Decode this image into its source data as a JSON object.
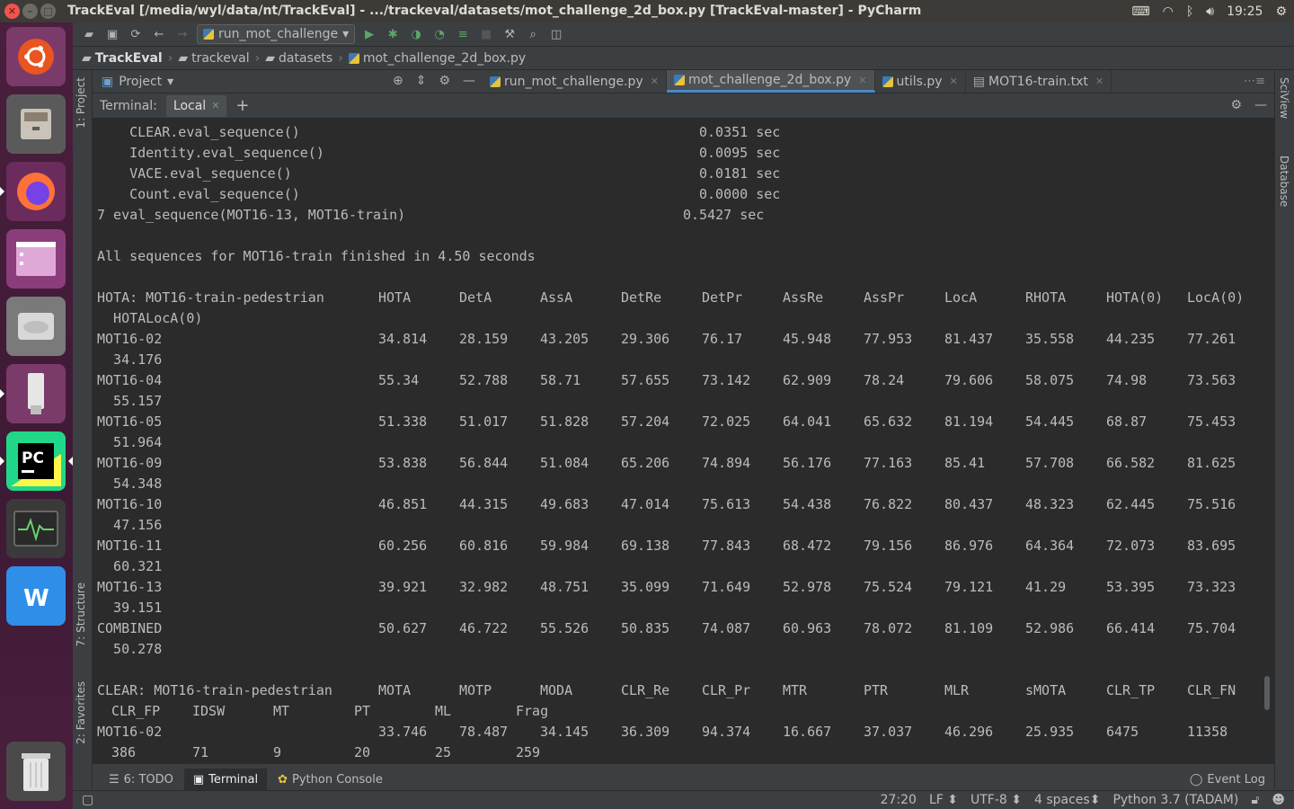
{
  "window": {
    "title": "TrackEval [/media/wyl/data/nt/TrackEval] - .../trackeval/datasets/mot_challenge_2d_box.py [TrackEval-master] - PyCharm",
    "clock": "19:25"
  },
  "toolbar": {
    "run_config": "run_mot_challenge"
  },
  "breadcrumb": [
    "TrackEval",
    "trackeval",
    "datasets",
    "mot_challenge_2d_box.py"
  ],
  "project_panel": {
    "label": "Project"
  },
  "editor_tabs": [
    {
      "label": "run_mot_challenge.py",
      "active": false
    },
    {
      "label": "mot_challenge_2d_box.py",
      "active": true
    },
    {
      "label": "utils.py",
      "active": false
    },
    {
      "label": "MOT16-train.txt",
      "active": false
    }
  ],
  "terminal": {
    "label": "Terminal:",
    "tab": "Local",
    "add": "+"
  },
  "side_tabs": {
    "project": "1: Project",
    "structure": "7: Structure",
    "favorites": "2: Favorites",
    "sciview": "SciView",
    "database": "Database"
  },
  "timing_lines": [
    {
      "name": "    CLEAR.eval_sequence()",
      "value": "0.0351 sec",
      "col": 675
    },
    {
      "name": "    Identity.eval_sequence()",
      "value": "0.0095 sec",
      "col": 675
    },
    {
      "name": "    VACE.eval_sequence()",
      "value": "0.0181 sec",
      "col": 675
    },
    {
      "name": "    Count.eval_sequence()",
      "value": "0.0000 sec",
      "col": 675
    },
    {
      "name": "7 eval_sequence(MOT16-13, MOT16-train)",
      "value": "0.5427 sec",
      "col": 657
    }
  ],
  "finished_msg": "All sequences for MOT16-train finished in 4.50 seconds",
  "hota_table": {
    "title": "HOTA: MOT16-train-pedestrian",
    "headers": [
      "HOTA",
      "DetA",
      "AssA",
      "DetRe",
      "DetPr",
      "AssRe",
      "AssPr",
      "LocA",
      "RHOTA",
      "HOTA(0)",
      "LocA(0)"
    ],
    "wrap_header": "  HOTALocA(0)",
    "rows": [
      {
        "name": "MOT16-02",
        "values": [
          "34.814",
          "28.159",
          "43.205",
          "29.306",
          "76.17",
          "45.948",
          "77.953",
          "81.437",
          "35.558",
          "44.235",
          "77.261"
        ],
        "wrap": "  34.176"
      },
      {
        "name": "MOT16-04",
        "values": [
          "55.34",
          "52.788",
          "58.71",
          "57.655",
          "73.142",
          "62.909",
          "78.24",
          "79.606",
          "58.075",
          "74.98",
          "73.563"
        ],
        "wrap": "  55.157"
      },
      {
        "name": "MOT16-05",
        "values": [
          "51.338",
          "51.017",
          "51.828",
          "57.204",
          "72.025",
          "64.041",
          "65.632",
          "81.194",
          "54.445",
          "68.87",
          "75.453"
        ],
        "wrap": "  51.964"
      },
      {
        "name": "MOT16-09",
        "values": [
          "53.838",
          "56.844",
          "51.084",
          "65.206",
          "74.894",
          "56.176",
          "77.163",
          "85.41",
          "57.708",
          "66.582",
          "81.625"
        ],
        "wrap": "  54.348"
      },
      {
        "name": "MOT16-10",
        "values": [
          "46.851",
          "44.315",
          "49.683",
          "47.014",
          "75.613",
          "54.438",
          "76.822",
          "80.437",
          "48.323",
          "62.445",
          "75.516"
        ],
        "wrap": "  47.156"
      },
      {
        "name": "MOT16-11",
        "values": [
          "60.256",
          "60.816",
          "59.984",
          "69.138",
          "77.843",
          "68.472",
          "79.156",
          "86.976",
          "64.364",
          "72.073",
          "83.695"
        ],
        "wrap": "  60.321"
      },
      {
        "name": "MOT16-13",
        "values": [
          "39.921",
          "32.982",
          "48.751",
          "35.099",
          "71.649",
          "52.978",
          "75.524",
          "79.121",
          "41.29",
          "53.395",
          "73.323"
        ],
        "wrap": "  39.151"
      },
      {
        "name": "COMBINED",
        "values": [
          "50.627",
          "46.722",
          "55.526",
          "50.835",
          "74.087",
          "60.963",
          "78.072",
          "81.109",
          "52.986",
          "66.414",
          "75.704"
        ],
        "wrap": "  50.278"
      }
    ]
  },
  "clear_table": {
    "title": "CLEAR: MOT16-train-pedestrian",
    "headers": [
      "MOTA",
      "MOTP",
      "MODA",
      "CLR_Re",
      "CLR_Pr",
      "MTR",
      "PTR",
      "MLR",
      "sMOTA",
      "CLR_TP",
      "CLR_FN"
    ],
    "wrap_headers": [
      "CLR_FP",
      "IDSW",
      "MT",
      "PT",
      "ML",
      "Frag"
    ],
    "rows": [
      {
        "name": "MOT16-02",
        "values": [
          "33.746",
          "78.487",
          "34.145",
          "36.309",
          "94.374",
          "16.667",
          "37.037",
          "46.296",
          "25.935",
          "6475",
          "11358"
        ],
        "wrap": [
          "386",
          "71",
          "9",
          "20",
          "25",
          "259"
        ]
      }
    ]
  },
  "bottom_tabs": [
    "6: TODO",
    "Terminal",
    "Python Console"
  ],
  "event_log": "Event Log",
  "status": {
    "position": "27:20",
    "line_sep": "LF",
    "encoding": "UTF-8",
    "indent": "4 spaces",
    "interpreter": "Python 3.7 (TADAM)"
  }
}
